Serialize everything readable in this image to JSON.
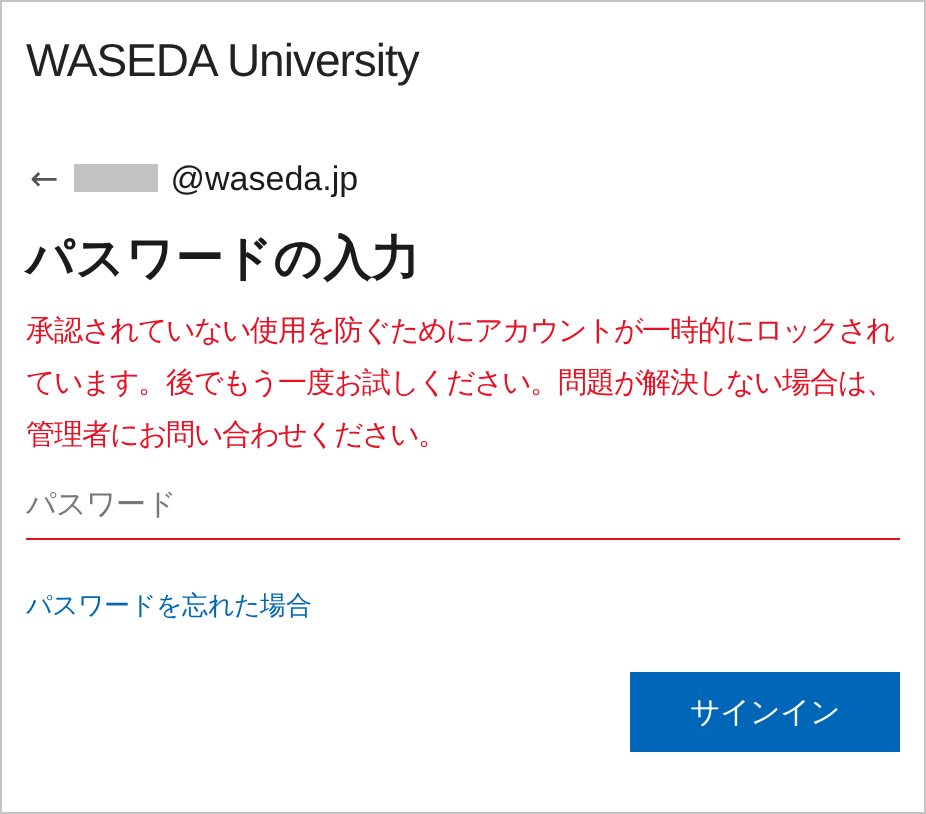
{
  "logo": {
    "text": "WASEDA University"
  },
  "account": {
    "back": "←",
    "redacted": true,
    "email": "@waseda.jp"
  },
  "title": "パスワードの入力",
  "error_message": "承認されていない使用を防ぐためにアカウントが一時的にロックされています。後でもう一度お試しください。問題が解決しない場合は、管理者にお問い合わせください。",
  "password_field": {
    "placeholder": "パスワード",
    "invalid": true
  },
  "forgot_link": "パスワードを忘れた場合",
  "buttons": [
    {
      "label": "サインイン",
      "kind": "primary"
    }
  ]
}
